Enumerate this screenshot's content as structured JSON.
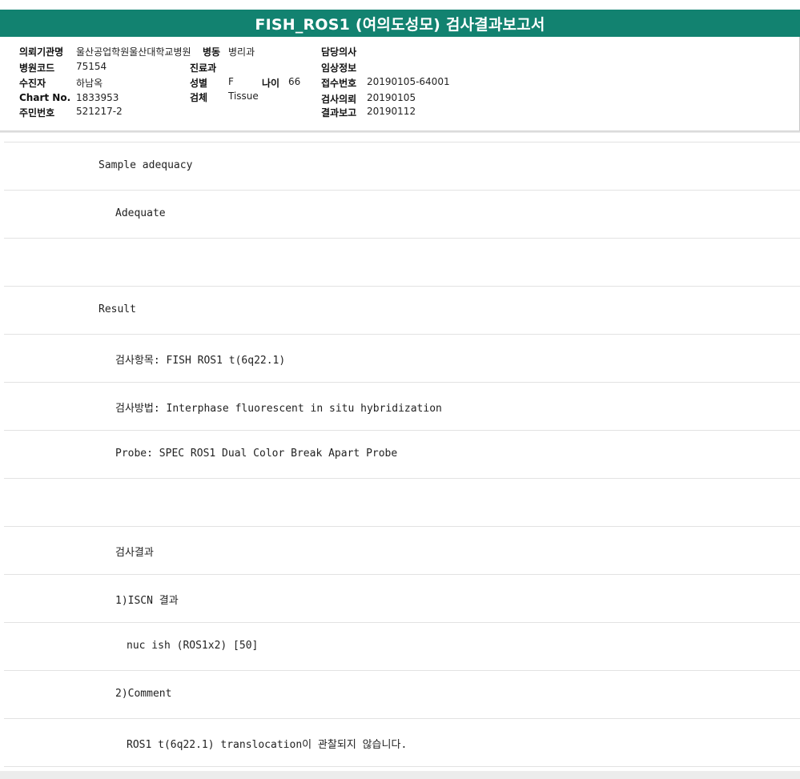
{
  "title": "FISH_ROS1 (여의도성모) 검사결과보고서",
  "info": {
    "institution_label": "의뢰기관명",
    "institution_value": "울산공업학원울산대학교병원",
    "ward_label": "병동",
    "ward_value": "병리과",
    "doctor_label": "담당의사",
    "doctor_value": "",
    "hospital_code_label": "병원코드",
    "hospital_code_value": "75154",
    "dept_label": "진료과",
    "dept_value": "",
    "clinical_label": "임상정보",
    "clinical_value": "",
    "patient_label": "수진자",
    "patient_value": "하남옥",
    "sex_label": "성별",
    "sex_value": "F",
    "age_label": "나이",
    "age_value": "66",
    "receipt_label": "접수번호",
    "receipt_value": "20190105-64001",
    "chart_label": "Chart No.",
    "chart_value": "1833953",
    "specimen_label": "검체",
    "specimen_value": "Tissue",
    "request_label": "검사의뢰",
    "request_value": "20190105",
    "id_label": "주민번호",
    "id_value": "521217-2",
    "report_label": "결과보고",
    "report_value": "20190112"
  },
  "report_lines": [
    {
      "text": "Sample adequacy",
      "indent": 0
    },
    {
      "text": "Adequate",
      "indent": 1
    },
    {
      "text": "",
      "indent": 0
    },
    {
      "text": "Result",
      "indent": 0
    },
    {
      "text": "검사항목: FISH ROS1 t(6q22.1)",
      "indent": 1
    },
    {
      "text": "검사방법: Interphase fluorescent in situ hybridization",
      "indent": 1
    },
    {
      "text": "Probe: SPEC ROS1 Dual Color Break Apart Probe",
      "indent": 1
    },
    {
      "text": "",
      "indent": 0
    },
    {
      "text": "검사결과",
      "indent": 1
    },
    {
      "text": "1)ISCN 결과",
      "indent": 1
    },
    {
      "text": "nuc ish (ROS1x2) [50]",
      "indent": 2
    },
    {
      "text": "2)Comment",
      "indent": 1
    },
    {
      "text": "ROS1 t(6q22.1) translocation이 관찰되지 않습니다.",
      "indent": 2
    }
  ]
}
